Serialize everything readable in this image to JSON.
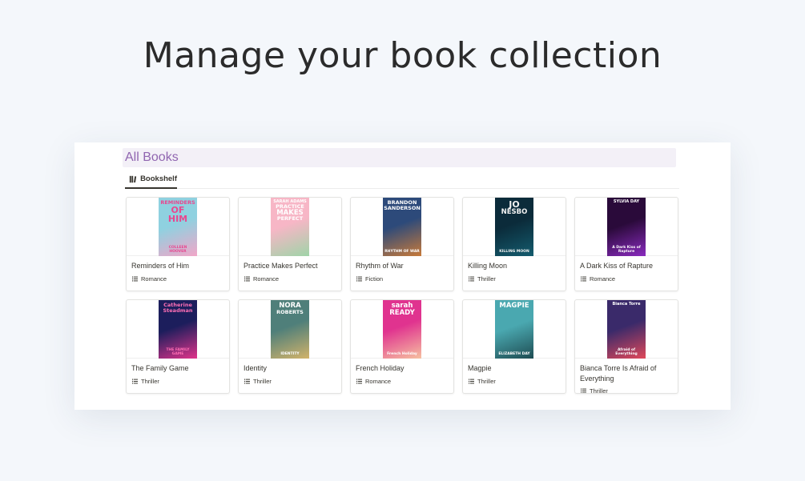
{
  "headline": "Manage your book collection",
  "database": {
    "title": "All Books",
    "view_tab": "Bookshelf"
  },
  "books": [
    {
      "title": "Reminders of Him",
      "genre": "Romance",
      "cover": {
        "lines": [
          "REMINDERS",
          "OF",
          "HIM"
        ],
        "author": "COLLEEN HOOVER",
        "bg": "#8fd1e0",
        "bg2": "#f2a6c8",
        "fg": "#e8478f"
      }
    },
    {
      "title": "Practice Makes Perfect",
      "genre": "Romance",
      "cover": {
        "lines": [
          "SARAH ADAMS",
          "PRACTICE",
          "MAKES",
          "PERFECT"
        ],
        "author": "",
        "bg": "#f7b6c6",
        "bg2": "#9fd4a8",
        "fg": "#ffffff"
      }
    },
    {
      "title": "Rhythm of War",
      "genre": "Fiction",
      "cover": {
        "lines": [
          "BRANDON",
          "SANDERSON"
        ],
        "author": "RHYTHM OF WAR",
        "bg": "#2d4a7a",
        "bg2": "#c87a3a",
        "fg": "#ffffff"
      }
    },
    {
      "title": "Killing Moon",
      "genre": "Thriller",
      "cover": {
        "lines": [
          "JO",
          "NESBO"
        ],
        "author": "KILLING MOON",
        "bg": "#0b2b3a",
        "bg2": "#145c6e",
        "fg": "#f2f2f2"
      }
    },
    {
      "title": "A Dark Kiss of Rapture",
      "genre": "Romance",
      "cover": {
        "lines": [
          "SYLVIA DAY"
        ],
        "author": "A Dark Kiss of Rapture",
        "bg": "#2a0a3a",
        "bg2": "#8a2bbf",
        "fg": "#ffffff"
      }
    },
    {
      "title": "The Family Game",
      "genre": "Thriller",
      "cover": {
        "lines": [
          "Catherine",
          "Steadman"
        ],
        "author": "THE FAMILY GAME",
        "bg": "#1c1e5c",
        "bg2": "#e0338a",
        "fg": "#ff6fb5"
      }
    },
    {
      "title": "Identity",
      "genre": "Thriller",
      "cover": {
        "lines": [
          "NORA",
          "ROBERTS"
        ],
        "author": "IDENTITY",
        "bg": "#4f7f7a",
        "bg2": "#d2b36a",
        "fg": "#ffffff"
      }
    },
    {
      "title": "French Holiday",
      "genre": "Romance",
      "cover": {
        "lines": [
          "sarah",
          "READY"
        ],
        "author": "French Holiday",
        "bg": "#e0338f",
        "bg2": "#f6c0a0",
        "fg": "#ffffff"
      }
    },
    {
      "title": "Magpie",
      "genre": "Thriller",
      "cover": {
        "lines": [
          "MAGPIE"
        ],
        "author": "ELIZABETH DAY",
        "bg": "#4aa8b0",
        "bg2": "#1e4c52",
        "fg": "#ffffff"
      }
    },
    {
      "title": "Bianca Torre Is Afraid of Everything",
      "genre": "Thriller",
      "cover": {
        "lines": [
          "Bianca Torre"
        ],
        "author": "Afraid of Everything",
        "bg": "#3a2a6a",
        "bg2": "#e0485a",
        "fg": "#ffffff"
      }
    }
  ]
}
